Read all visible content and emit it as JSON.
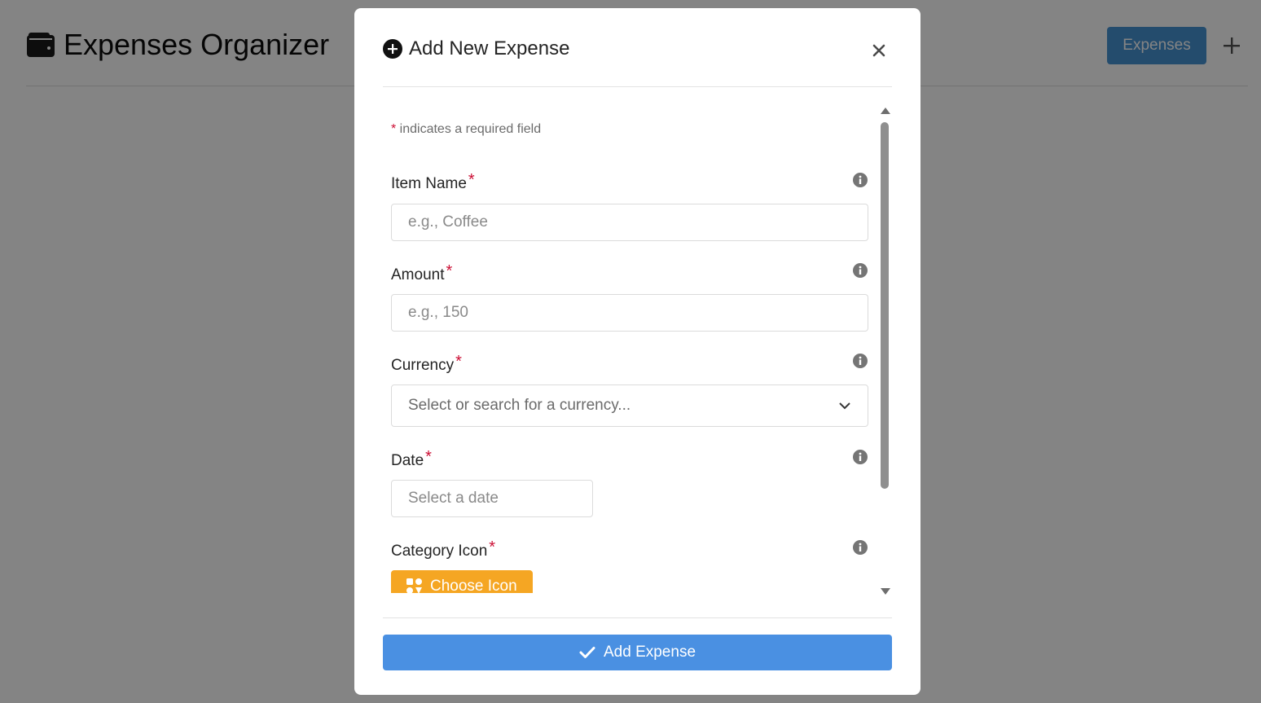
{
  "app": {
    "title": "Expenses Organizer",
    "title_icon": "wallet-icon",
    "nav_button": "Expenses",
    "add_icon": "plus-icon"
  },
  "modal": {
    "title": "Add New Expense",
    "title_icon": "plus-circle-icon",
    "close_icon": "close-icon",
    "required_note": {
      "star": "*",
      "text": " indicates a required field"
    },
    "fields": {
      "item_name": {
        "label": "Item Name",
        "placeholder": "e.g., Coffee"
      },
      "amount": {
        "label": "Amount",
        "placeholder": "e.g., 150"
      },
      "currency": {
        "label": "Currency",
        "placeholder": "Select or search for a currency..."
      },
      "date": {
        "label": "Date",
        "placeholder": "Select a date"
      },
      "category_icon": {
        "label": "Category Icon",
        "button": "Choose Icon"
      }
    },
    "required_star": "*",
    "submit_label": "Add Expense"
  },
  "colors": {
    "primary": "#4a90e2",
    "nav_button": "#3e8ed0",
    "warning": "#f5a623",
    "required": "#cc0f35",
    "overlay": "rgba(10,10,10,0.5)"
  }
}
